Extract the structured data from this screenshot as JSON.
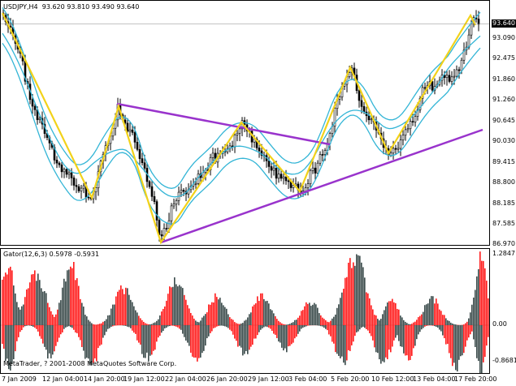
{
  "main_chart": {
    "symbol_info": "USDJPY,H4",
    "ohlc": "93.620 93.810 93.490 93.640",
    "current_price": "93.640",
    "price_scale": [
      "93.090",
      "92.475",
      "91.860",
      "91.260",
      "90.645",
      "90.030",
      "89.415",
      "88.800",
      "88.185",
      "87.585",
      "86.970"
    ]
  },
  "indicator": {
    "title": "Gator(12,6,3)",
    "values": "0.5978 -0.5931",
    "scale_top": "1.2847",
    "scale_zero": "0.00",
    "scale_bottom": "-0.8681",
    "copyright": "MetaTrader, ? 2001-2008 MetaQuotes Software Corp."
  },
  "time_axis": [
    "7 Jan 2009",
    "12 Jan 04:00",
    "14 Jan 20:00",
    "19 Jan 12:00",
    "22 Jan 04:00",
    "26 Jan 20:00",
    "29 Jan 12:00",
    "3 Feb 04:00",
    "5 Feb 20:00",
    "10 Feb 12:00",
    "13 Feb 04:00",
    "17 Feb 20:00"
  ],
  "colors": {
    "zigzag": "#f2d21a",
    "trendline": "#9933cc",
    "bands": "#33b5d6",
    "candle": "#000000",
    "gator_up": "#ff1a1a",
    "gator_down": "#3a4a4a"
  }
}
